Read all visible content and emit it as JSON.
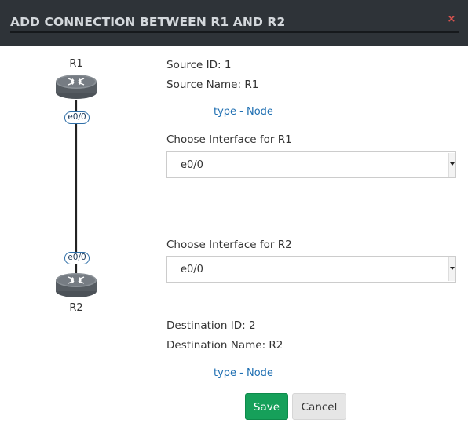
{
  "modal": {
    "title": "ADD CONNECTION BETWEEN R1 AND R2",
    "close_icon": "×"
  },
  "topology": {
    "source_node": {
      "name": "R1",
      "interface": "e0/0",
      "icon": "router-icon"
    },
    "destination_node": {
      "name": "R2",
      "interface": "e0/0",
      "icon": "router-icon"
    }
  },
  "source": {
    "id_line": "Source ID: 1",
    "name_line": "Source Name: R1",
    "type_link": "type - Node",
    "interface_label": "Choose Interface for R1",
    "interface_value": "e0/0"
  },
  "destination": {
    "interface_label": "Choose Interface for R2",
    "interface_value": "e0/0",
    "id_line": "Destination ID: 2",
    "name_line": "Destination Name: R2",
    "type_link": "type - Node"
  },
  "buttons": {
    "save": "Save",
    "cancel": "Cancel"
  },
  "colors": {
    "header_bg": "#2e3338",
    "save_bg": "#16a05a",
    "link": "#1f6fb2",
    "close": "#d9534f"
  }
}
